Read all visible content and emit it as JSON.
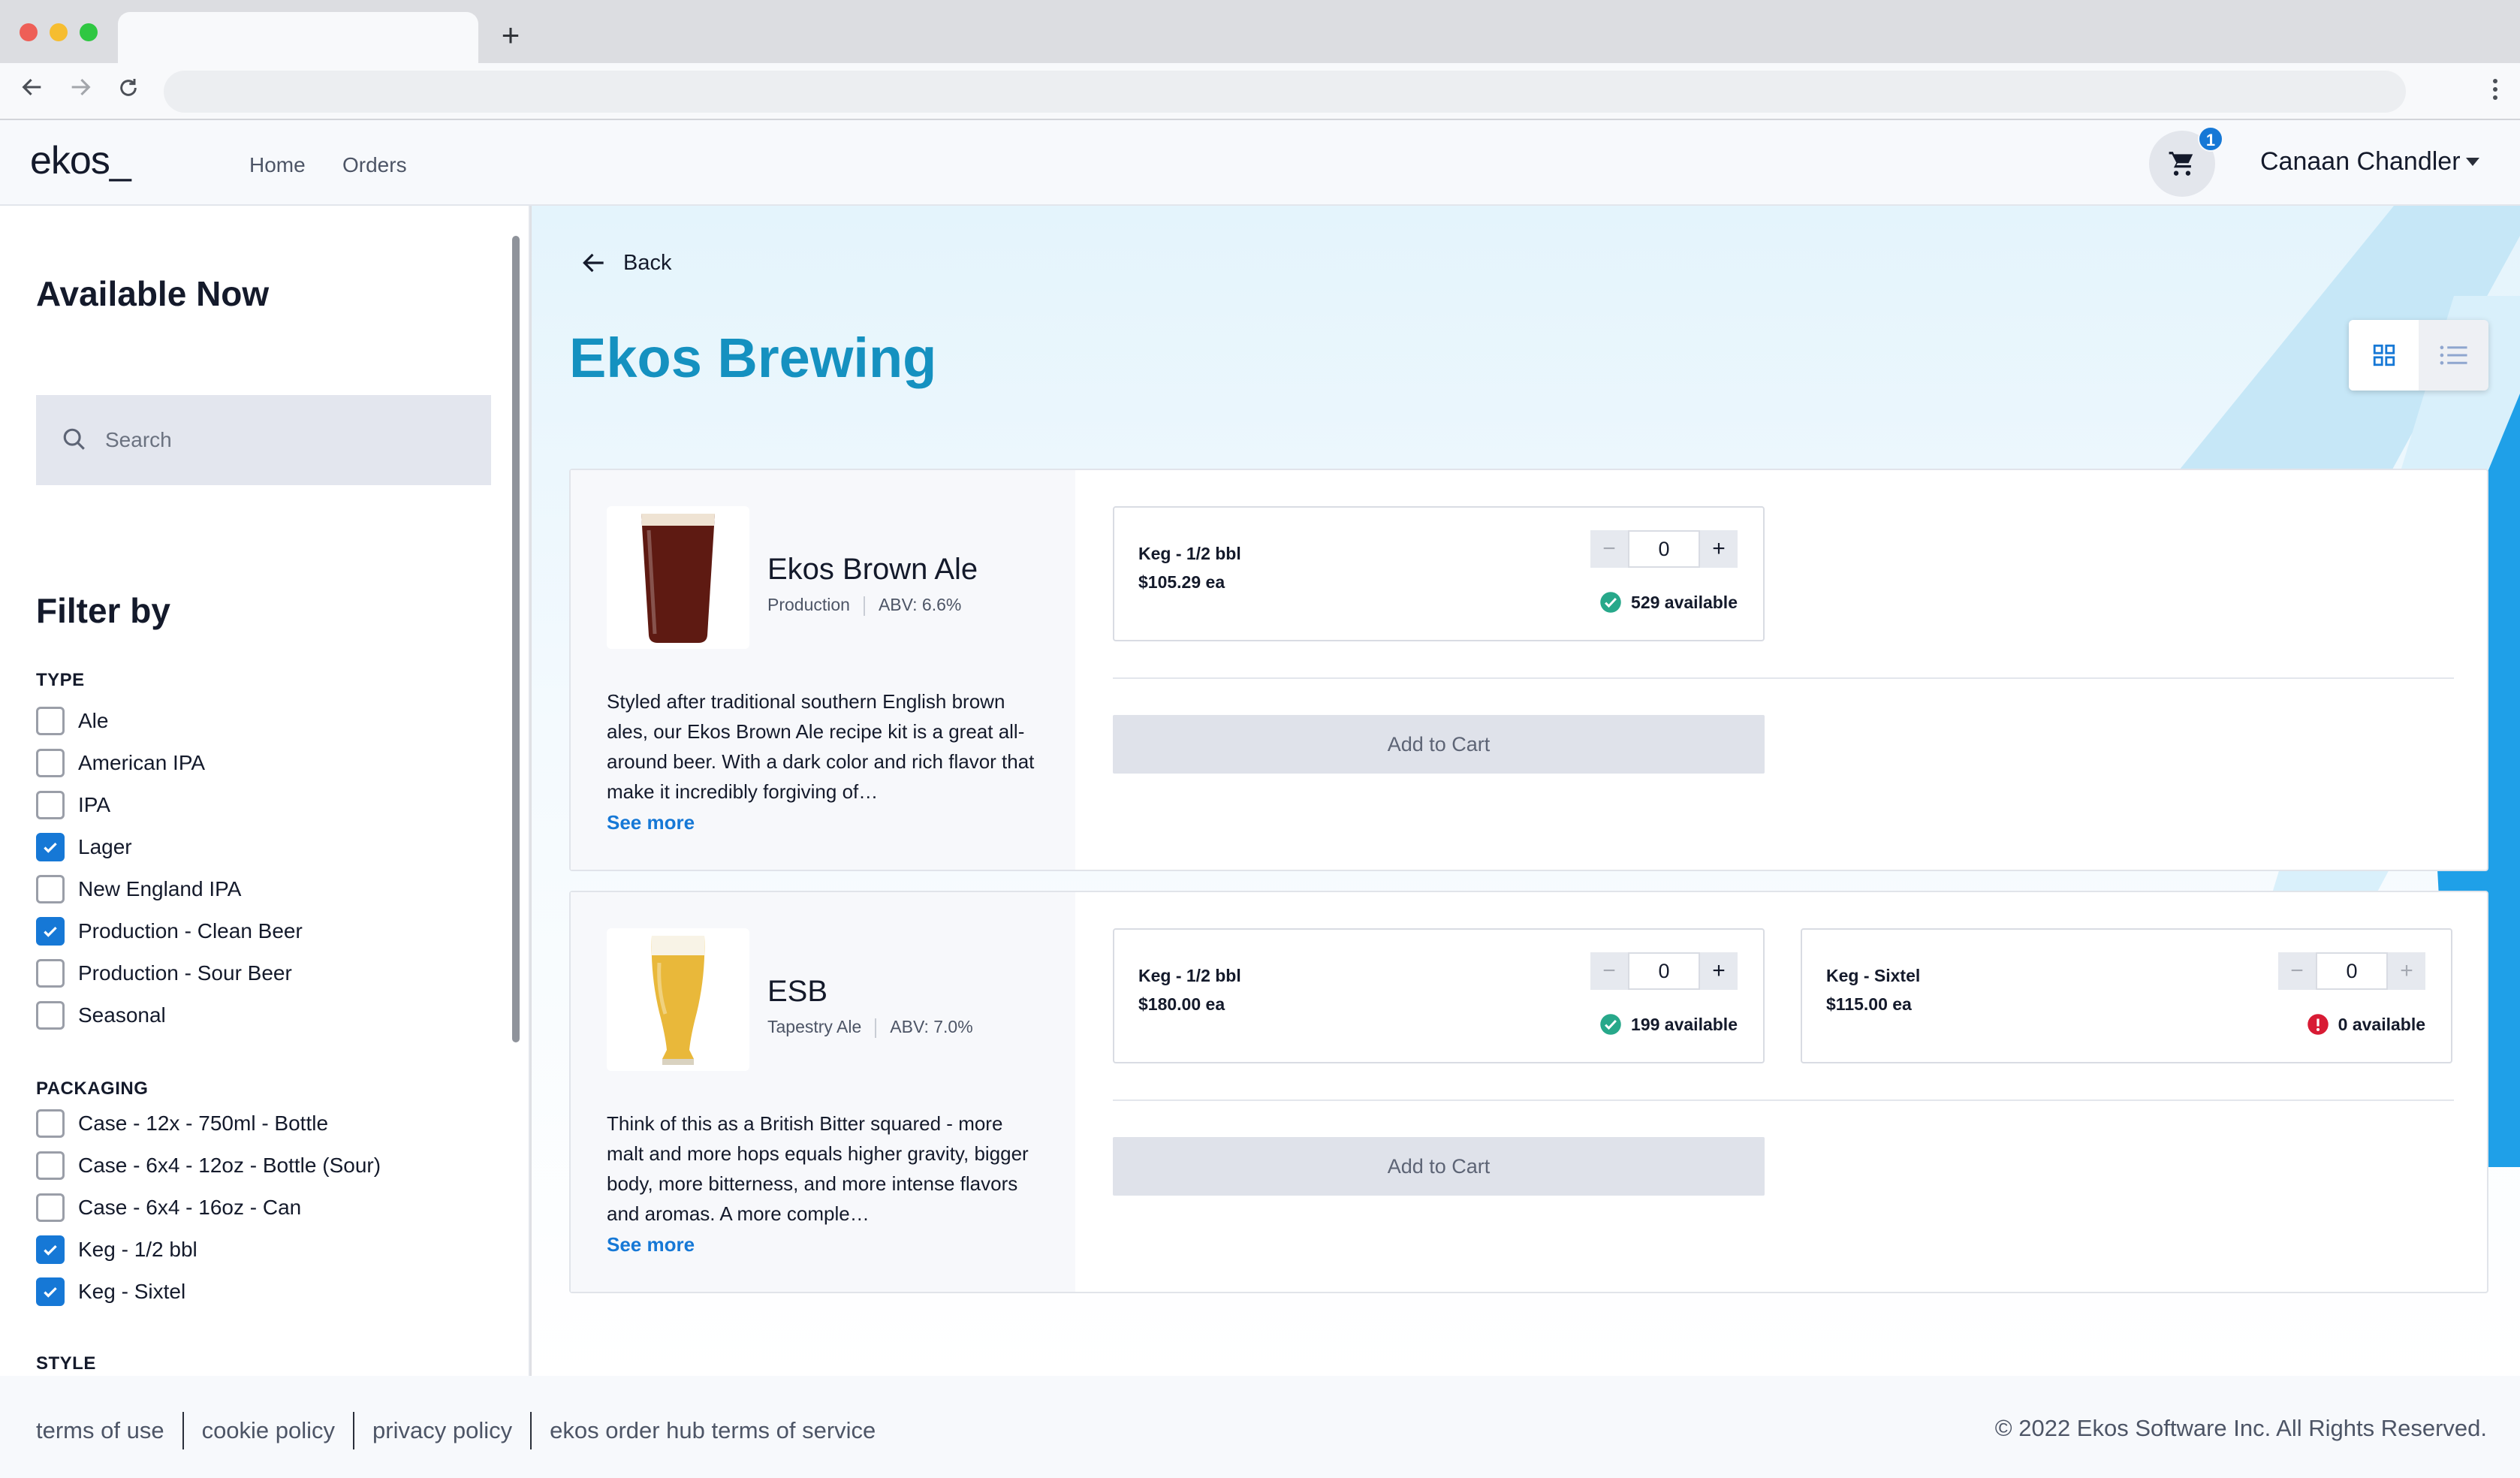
{
  "browser": {
    "new_tab_symbol": "+",
    "back_icon": "arrow-left-icon",
    "forward_icon": "arrow-right-icon",
    "reload_icon": "reload-icon"
  },
  "header": {
    "logo": "ekos_",
    "nav": [
      {
        "label": "Home"
      },
      {
        "label": "Orders"
      }
    ],
    "cart_count": "1",
    "user_name": "Canaan Chandler"
  },
  "sidebar": {
    "title": "Available Now",
    "search_placeholder": "Search",
    "filter_title": "Filter by",
    "groups": [
      {
        "title": "TYPE",
        "options": [
          {
            "label": "Ale",
            "checked": false
          },
          {
            "label": "American IPA",
            "checked": false
          },
          {
            "label": "IPA",
            "checked": false
          },
          {
            "label": "Lager",
            "checked": true
          },
          {
            "label": "New England IPA",
            "checked": false
          },
          {
            "label": "Production - Clean Beer",
            "checked": true
          },
          {
            "label": "Production - Sour Beer",
            "checked": false
          },
          {
            "label": "Seasonal",
            "checked": false
          }
        ]
      },
      {
        "title": "PACKAGING",
        "options": [
          {
            "label": "Case - 12x - 750ml - Bottle",
            "checked": false
          },
          {
            "label": "Case - 6x4 - 12oz - Bottle (Sour)",
            "checked": false
          },
          {
            "label": "Case - 6x4 - 16oz - Can",
            "checked": false
          },
          {
            "label": "Keg - 1/2 bbl",
            "checked": true
          },
          {
            "label": "Keg - Sixtel",
            "checked": true
          }
        ]
      },
      {
        "title": "STYLE",
        "options": []
      }
    ]
  },
  "main": {
    "back_label": "Back",
    "title": "Ekos Brewing",
    "view_modes": [
      "grid",
      "list"
    ],
    "active_view": "grid",
    "add_to_cart_label": "Add to Cart",
    "see_more_label": "See more",
    "products": [
      {
        "name": "Ekos Brown Ale",
        "category": "Production",
        "abv": "ABV: 6.6%",
        "description": "Styled after traditional southern English brown ales, our Ekos Brown Ale recipe kit is a great all-around beer. With a dark color and rich flavor that make it incredibly forgiving of…",
        "beer_color": "#5e1a12",
        "variants": [
          {
            "name": "Keg - 1/2 bbl",
            "price": "$105.29 ea",
            "quantity": "0",
            "available": "529 available",
            "in_stock": true
          }
        ]
      },
      {
        "name": "ESB",
        "category": "Tapestry Ale",
        "abv": "ABV: 7.0%",
        "description": "Think of this as a British Bitter squared - more malt and more hops equals higher gravity, bigger body, more bitterness, and more intense flavors and aromas. A more comple…",
        "beer_color": "#e9b83a",
        "variants": [
          {
            "name": "Keg - 1/2 bbl",
            "price": "$180.00 ea",
            "quantity": "0",
            "available": "199 available",
            "in_stock": true
          },
          {
            "name": "Keg - Sixtel",
            "price": "$115.00 ea",
            "quantity": "0",
            "available": "0 available",
            "in_stock": false
          }
        ]
      }
    ]
  },
  "footer": {
    "links": [
      "terms of use",
      "cookie policy",
      "privacy policy",
      "ekos order hub terms of service"
    ],
    "copyright": "© 2022 Ekos Software Inc. All Rights Reserved."
  },
  "colors": {
    "accent": "#1678d6",
    "title": "#1591c0",
    "success": "#27a88a",
    "error": "#d81b34"
  }
}
